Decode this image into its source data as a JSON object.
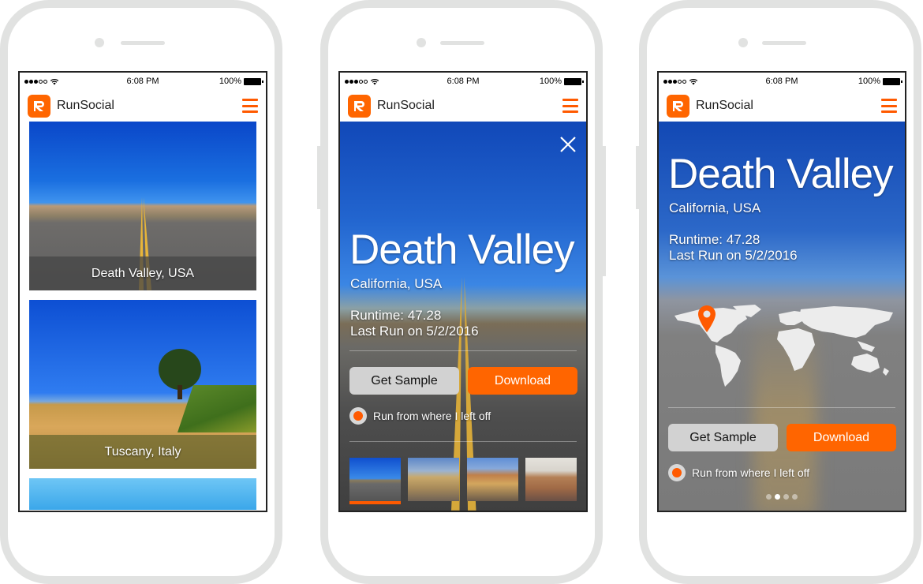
{
  "status_bar": {
    "time": "6:08 PM",
    "battery": "100%",
    "signal_bars_filled": 3,
    "signal_bars_total": 5
  },
  "app": {
    "name": "RunSocial",
    "logo_letter": "R",
    "accent_color": "#ff6500"
  },
  "screen_list": {
    "items": [
      {
        "caption": "Death Valley, USA"
      },
      {
        "caption": "Tuscany, Italy"
      },
      {
        "caption": ""
      }
    ]
  },
  "screen_detail": {
    "title": "Death Valley",
    "subtitle": "California, USA",
    "runtime": "Runtime: 47.28",
    "last_run": "Last Run on 5/2/2016",
    "get_sample_label": "Get Sample",
    "download_label": "Download",
    "resume_option_label": "Run from where I left off",
    "resume_option_selected": true,
    "thumbnails_count": 4,
    "active_thumbnail": 1
  },
  "screen_map": {
    "title": "Death Valley",
    "subtitle": "California, USA",
    "runtime": "Runtime: 47.28",
    "last_run": "Last Run on 5/2/2016",
    "get_sample_label": "Get Sample",
    "download_label": "Download",
    "resume_option_label": "Run from where I left off",
    "resume_option_selected": true,
    "page_dots_total": 4,
    "page_dots_active": 2
  }
}
